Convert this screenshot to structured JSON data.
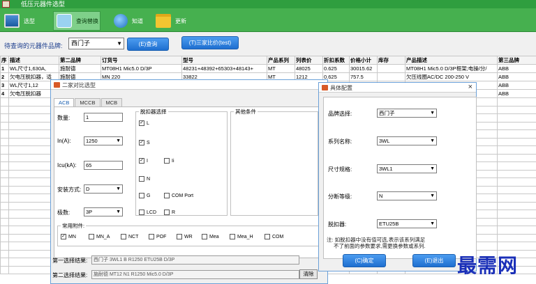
{
  "window": {
    "title": "低压元器件选型"
  },
  "toolbar": {
    "items": [
      {
        "label": "选型",
        "icon": "monitor-icon"
      },
      {
        "label": "查询替换",
        "icon": "swap-icon"
      },
      {
        "label": "知道",
        "icon": "globe-icon"
      },
      {
        "label": "更新",
        "icon": "folder-icon"
      }
    ]
  },
  "search": {
    "label": "待查询的元器件品牌:",
    "brand_value": "西门子",
    "query_button": "(E)查询",
    "compare_button": "(T)三家比价(test)"
  },
  "table": {
    "columns": [
      "序",
      "描述",
      "第二品牌",
      "订货号",
      "型号",
      "产品系列",
      "列表价",
      "折扣系数",
      "价格小计",
      "库存",
      "产品描述",
      "第三品牌"
    ],
    "rows": [
      [
        "1",
        "WL尺寸1,630A,",
        "施耐德",
        "MT08H1 Mic5.0 D/3P",
        "48231+48392+65303+48143+",
        "MT",
        "48025",
        "0.625",
        "30015.62",
        "",
        "MT08H1 Mic5.0 D/3P框架;电操/分/",
        "ABB"
      ],
      [
        "2",
        "欠电压脱扣器，适",
        "施耐德",
        "MN 220",
        "33822",
        "MT",
        "1212",
        "0.625",
        "757.5",
        "",
        "欠压线圈AC/DC 200-250 V",
        "ABB"
      ],
      [
        "3",
        "WL尺寸1,12",
        "",
        "",
        "",
        "",
        "",
        "",
        "",
        "",
        "3P框架;电操/分/",
        "ABB"
      ],
      [
        "4",
        "欠电压脱扣器",
        "",
        "",
        "",
        "",
        "",
        "",
        "",
        "",
        "250 V",
        "ABB"
      ]
    ]
  },
  "dialog_main": {
    "title": "二家对比选型",
    "tabs": [
      "ACB",
      "MCCB",
      "MCB"
    ],
    "fields": {
      "quantity_label": "数量:",
      "quantity_value": "1",
      "in_label": "In(A):",
      "in_value": "1250",
      "icu_label": "Icu(kA):",
      "icu_value": "65",
      "mount_label": "安装方式:",
      "mount_value": "D",
      "poles_label": "极数:",
      "poles_value": "3P"
    },
    "trip_group": {
      "title": "脱扣器选择",
      "options": [
        {
          "label": "L",
          "checked": true
        },
        {
          "label": "S",
          "checked": true
        },
        {
          "label": "I",
          "checked": true
        },
        {
          "label": "Ii",
          "checked": false
        },
        {
          "label": "N",
          "checked": false
        },
        {
          "label": "G",
          "checked": false
        },
        {
          "label": "COM Port",
          "checked": false
        },
        {
          "label": "LCD",
          "checked": false
        },
        {
          "label": "R",
          "checked": false
        }
      ]
    },
    "other_group": {
      "title": "其他条件"
    },
    "accessory_group": {
      "title": "常用附件:",
      "options": [
        {
          "label": "MN",
          "checked": true
        },
        {
          "label": "MN_A",
          "checked": false
        },
        {
          "label": "NCT",
          "checked": false
        },
        {
          "label": "POF",
          "checked": false
        },
        {
          "label": "WR",
          "checked": false
        },
        {
          "label": "Mea",
          "checked": false
        },
        {
          "label": "Mea_H",
          "checked": false
        },
        {
          "label": "COM",
          "checked": false
        }
      ]
    },
    "result1_label": "第一选择结果:",
    "result1_value": "西门子 3WL1 B R1250 ETU25B D/3P",
    "result2_label": "第二选择结果:",
    "result2_value": "施耐德 MT12 N1 R1250 Mic5.0 D/3P",
    "clear_button": "清除"
  },
  "dialog_config": {
    "title": "具体配置",
    "brand_label": "品牌选择:",
    "brand_value": "西门子",
    "series_label": "系列名称:",
    "series_value": "3WL",
    "size_label": "尺寸规格:",
    "size_value": "3WL1",
    "break_label": "分断等级:",
    "break_value": "N",
    "trip_label": "脱扣器:",
    "trip_value": "ETU25B",
    "note_line1": "注: 如脱扣器中没有值可选,表示该系列满足",
    "note_line2": "不了前面的参数要求,需更换参数或系列.",
    "ok_button": "(C)确定",
    "exit_button": "(E)退出"
  },
  "watermark": "最需网"
}
